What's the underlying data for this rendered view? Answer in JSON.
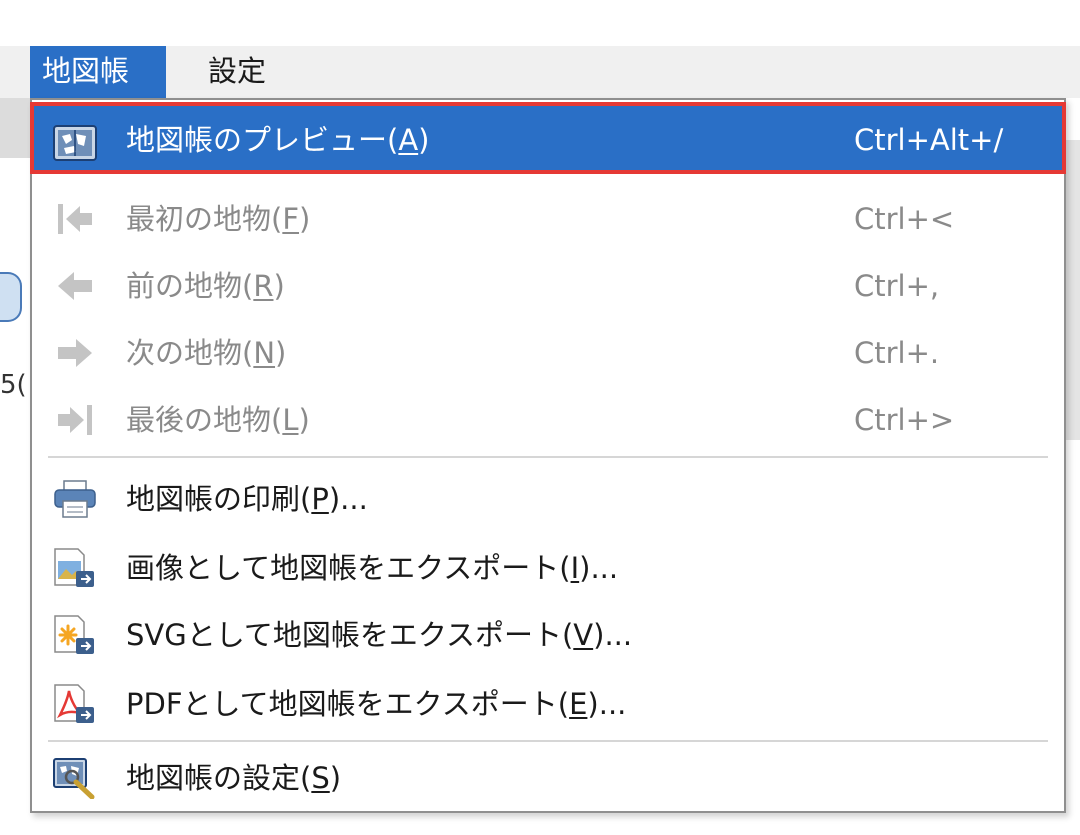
{
  "menubar": {
    "items": [
      {
        "label": "地図帳"
      },
      {
        "label": "設定"
      }
    ]
  },
  "background": {
    "peek_text": "5("
  },
  "menu": {
    "items": [
      {
        "label": "地図帳のプレビュー(",
        "mnemonic": "A",
        "suffix": ")",
        "shortcut": "Ctrl+Alt+/",
        "icon": "atlas-preview-icon",
        "state": "highlighted"
      },
      {
        "label": "最初の地物(",
        "mnemonic": "F",
        "suffix": ")",
        "shortcut": "Ctrl+<",
        "icon": "first-feature-icon",
        "state": "disabled"
      },
      {
        "label": "前の地物(",
        "mnemonic": "R",
        "suffix": ")",
        "shortcut": "Ctrl+,",
        "icon": "previous-feature-icon",
        "state": "disabled"
      },
      {
        "label": "次の地物(",
        "mnemonic": "N",
        "suffix": ")",
        "shortcut": "Ctrl+.",
        "icon": "next-feature-icon",
        "state": "disabled"
      },
      {
        "label": "最後の地物(",
        "mnemonic": "L",
        "suffix": ")",
        "shortcut": "Ctrl+>",
        "icon": "last-feature-icon",
        "state": "disabled"
      },
      {
        "label": "地図帳の印刷(",
        "mnemonic": "P",
        "suffix": ")...",
        "shortcut": "",
        "icon": "printer-icon",
        "state": "enabled"
      },
      {
        "label": "画像として地図帳をエクスポート(",
        "mnemonic": "I",
        "suffix": ")...",
        "shortcut": "",
        "icon": "export-image-icon",
        "state": "enabled"
      },
      {
        "label": "SVGとして地図帳をエクスポート(",
        "mnemonic": "V",
        "suffix": ")...",
        "shortcut": "",
        "icon": "export-svg-icon",
        "state": "enabled"
      },
      {
        "label": "PDFとして地図帳をエクスポート(",
        "mnemonic": "E",
        "suffix": ")...",
        "shortcut": "",
        "icon": "export-pdf-icon",
        "state": "enabled"
      },
      {
        "label": "地図帳の設定(",
        "mnemonic": "S",
        "suffix": ")",
        "shortcut": "",
        "icon": "atlas-settings-icon",
        "state": "enabled"
      }
    ]
  },
  "colors": {
    "highlight": "#2a6fc6",
    "highlight_border": "#e53935",
    "disabled_text": "#8a8a8a"
  }
}
